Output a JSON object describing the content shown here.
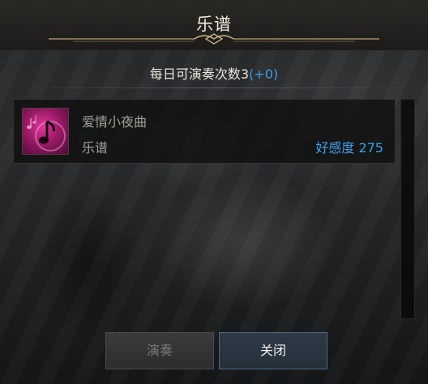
{
  "dialog": {
    "title": "乐谱",
    "counter_label": "每日可演奏次数3",
    "counter_bonus": "(+0)"
  },
  "list": {
    "items": [
      {
        "name": "爱情小夜曲",
        "type": "乐谱",
        "affinity": "好感度 275",
        "icon": "music-score-icon"
      }
    ]
  },
  "buttons": {
    "play_label": "演奏",
    "close_label": "关闭"
  },
  "colors": {
    "accent_blue": "#3f9ee8",
    "title_text": "#f2ede0",
    "muted_text": "#a3a09a"
  }
}
